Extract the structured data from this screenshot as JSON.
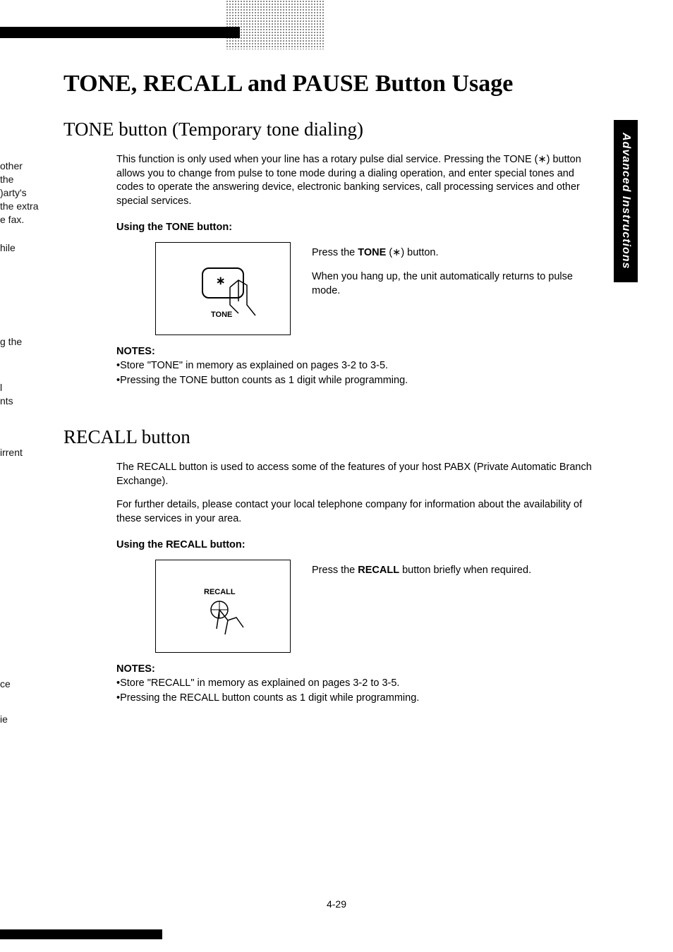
{
  "tab": "Advanced Instructions",
  "title": "TONE, RECALL and PAUSE Button Usage",
  "tone": {
    "heading": "TONE button (Temporary tone dialing)",
    "intro": "This function is only used when your line has a rotary pulse dial service. Pressing the TONE (∗) button allows you to change from pulse to tone mode during a dialing operation, and enter special tones and codes to operate the answering device, electronic banking services, call processing services and other special services.",
    "using": "Using the TONE button:",
    "key_label": "TONE",
    "key_sym": "∗",
    "caption1_a": "Press the ",
    "caption1_b": "TONE",
    "caption1_c": " (∗) button.",
    "caption2": "When you hang up, the unit automatically returns to pulse mode.",
    "notes_h": "NOTES:",
    "note1": "•Store \"TONE\" in memory as explained on pages 3-2 to 3-5.",
    "note2": "•Pressing the TONE button counts as 1 digit while programming."
  },
  "recall": {
    "heading": "RECALL button",
    "p1": "The RECALL button is used to access some of the features of your host PABX (Private Automatic Branch Exchange).",
    "p2": "For further details, please contact your local telephone company for information about the availability of these services in your area.",
    "using": "Using the RECALL button:",
    "key_label": "RECALL",
    "caption_a": "Press the ",
    "caption_b": "RECALL",
    "caption_c": " button briefly when required.",
    "notes_h": "NOTES:",
    "note1": "•Store \"RECALL\" in memory as explained on pages 3-2 to 3-5.",
    "note2": "•Pressing the RECALL button counts as 1 digit while programming."
  },
  "fragments": {
    "f1": "other",
    "f2": "the",
    "f3": ")arty's",
    "f4": "the extra",
    "f5": "e fax.",
    "f6": "hile",
    "f7": "g the",
    "f8": "l",
    "f9": "nts",
    "f10": "irrent",
    "f11": "ce",
    "f12": "ie"
  },
  "pagenum": "4-29"
}
